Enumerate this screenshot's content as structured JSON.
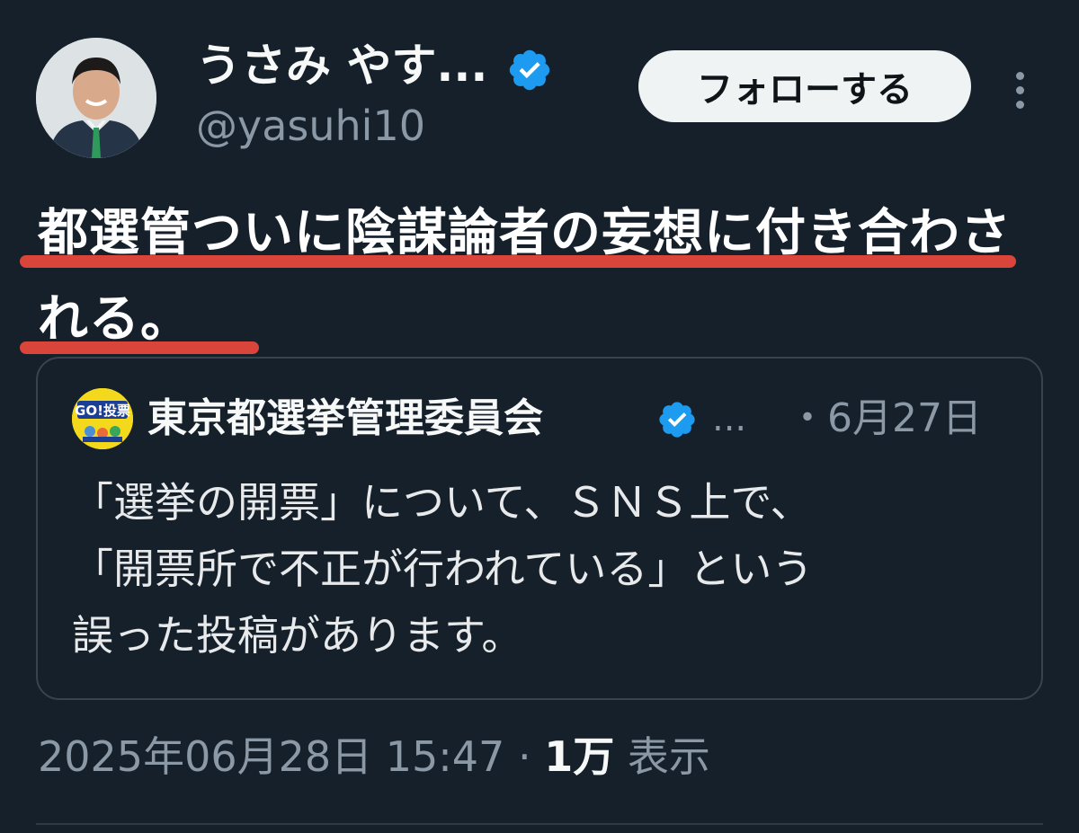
{
  "tweet": {
    "author": {
      "display_name": "うさみ やす...",
      "handle": "@yasuhi10",
      "verified": true,
      "avatar_icon": "profile-photo"
    },
    "follow_label": "フォローする",
    "text": "都選管ついに陰謀論者の妄想に付き合わされる。",
    "highlight_color": "#d9453a"
  },
  "quote": {
    "author": {
      "display_name": "東京都選挙管理委員会",
      "verified": true,
      "ellipsis": "...",
      "avatar_icon": "go-vote-logo",
      "avatar_text": "GO!投票"
    },
    "date": "・6月27日",
    "text": "「選挙の開票」について、ＳＮＳ上で、\n「開票所で不正が行われている」という\n誤った投稿があります。"
  },
  "meta": {
    "datetime": "2025年06月28日 15:47",
    "separator": " · ",
    "views_count": "1万",
    "views_label": "表示"
  },
  "colors": {
    "background": "#15202b",
    "verified_badge": "#1d9bf0",
    "muted_text": "#8b98a5"
  }
}
